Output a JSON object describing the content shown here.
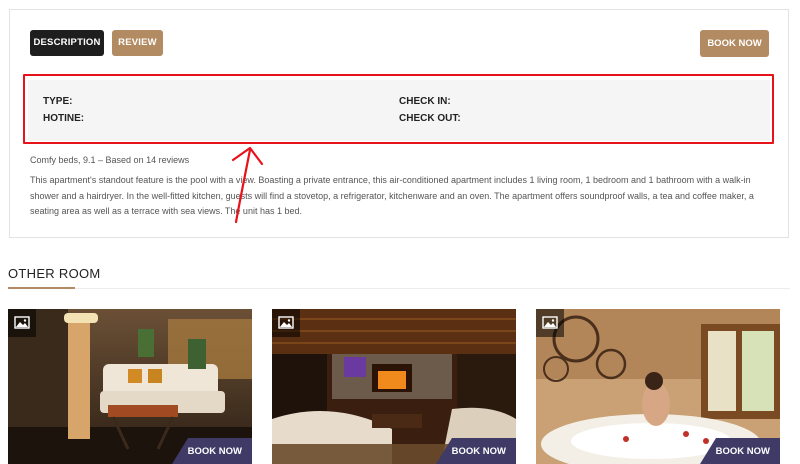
{
  "tabs": {
    "description_label": "DESCRIPTION",
    "review_label": "REVIEW"
  },
  "book_now_label": "BOOK NOW",
  "info": {
    "type_label": "TYPE:",
    "hotine_label": "HOTINE:",
    "check_in_label": "CHECK IN:",
    "check_out_label": "CHECK OUT:"
  },
  "rating_text": "Comfy beds, 9.1 – Based on 14 reviews",
  "description_text": "This apartment's standout feature is the pool with a view. Boasting a private entrance, this air-conditioned apartment includes 1 living room, 1 bedroom and 1 bathroom with a walk-in shower and a hairdryer. In the well-fitted kitchen, guests will find a stovetop, a refrigerator, kitchenware and an oven. The apartment offers soundproof walls, a tea and coffee maker, a seating area as well as a terrace with sea views. The unit has 1 bed.",
  "other_room": {
    "title": "OTHER ROOM",
    "rooms": [
      {
        "book_label": "BOOK NOW",
        "image_icon": "image-icon"
      },
      {
        "book_label": "BOOK NOW",
        "image_icon": "image-icon"
      },
      {
        "book_label": "BOOK NOW",
        "image_icon": "image-icon"
      }
    ]
  },
  "colors": {
    "accent": "#b38b62",
    "dark": "#1e1e1e",
    "annotation": "#e8121a",
    "book_badge": "#3f3a66"
  }
}
